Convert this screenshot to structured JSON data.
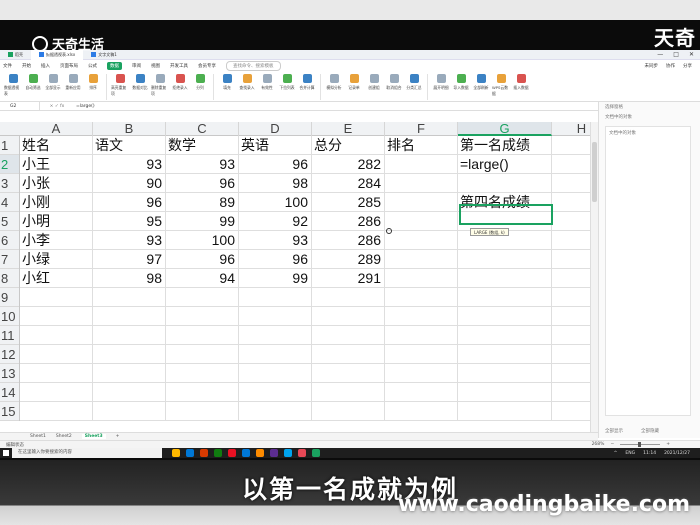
{
  "watermark": {
    "logo_text": "天奇生活",
    "corner_text": "天奇",
    "url": "www.caodingbaike.com"
  },
  "caption": "以第一名成就为例",
  "titlebar": {
    "tabs": [
      {
        "label": "稻壳"
      },
      {
        "label": "数据透视表.xlsx",
        "active": true
      },
      {
        "label": "文字文稿1"
      }
    ],
    "controls": [
      "—",
      "□",
      "✕"
    ]
  },
  "menubar": {
    "items": [
      "文件",
      "开始",
      "插入",
      "页面布局",
      "公式",
      "数据",
      "审阅",
      "视图",
      "开发工具",
      "会员专享"
    ],
    "active_index": 5,
    "search_placeholder": "查找命令、搜索模板",
    "right": [
      "未同步",
      "协作",
      "分享"
    ]
  },
  "ribbon": {
    "buttons": [
      {
        "label": "数据透视表",
        "color": "b"
      },
      {
        "label": "自动筛选",
        "color": "g"
      },
      {
        "label": "全部显示",
        "color": ""
      },
      {
        "label": "重新应用",
        "color": ""
      },
      {
        "label": "排序",
        "color": "o"
      },
      {
        "label": "高亮重复项",
        "color": "r"
      },
      {
        "label": "数据对比",
        "color": "b"
      },
      {
        "label": "删除重复项",
        "color": ""
      },
      {
        "label": "拒绝录入",
        "color": "r"
      },
      {
        "label": "分列",
        "color": "g"
      },
      {
        "label": "填充",
        "color": "b"
      },
      {
        "label": "查找录入",
        "color": "o"
      },
      {
        "label": "有效性",
        "color": ""
      },
      {
        "label": "下拉列表",
        "color": "g"
      },
      {
        "label": "合并计算",
        "color": "b"
      },
      {
        "label": "模拟分析",
        "color": ""
      },
      {
        "label": "记录单",
        "color": "o"
      },
      {
        "label": "创建组",
        "color": ""
      },
      {
        "label": "取消组合",
        "color": ""
      },
      {
        "label": "分类汇总",
        "color": "b"
      },
      {
        "label": "展开明细",
        "color": ""
      },
      {
        "label": "导入数据",
        "color": "g"
      },
      {
        "label": "全部刷新",
        "color": "b"
      },
      {
        "label": "WPS云数据",
        "color": "o"
      },
      {
        "label": "插入数据",
        "color": "r"
      }
    ]
  },
  "formula_bar": {
    "name_box": "G2",
    "fx": "× ✓ fx",
    "formula": "=large()"
  },
  "grid": {
    "columns": [
      "A",
      "B",
      "C",
      "D",
      "E",
      "F",
      "G",
      "H"
    ],
    "selected_column": "G",
    "row_numbers": [
      "1",
      "2",
      "3",
      "4",
      "5",
      "6",
      "7",
      "8",
      "9",
      "10",
      "11",
      "12",
      "13",
      "14",
      "15"
    ],
    "selected_row": "2",
    "rows": [
      [
        "姓名",
        "语文",
        "数学",
        "英语",
        "总分",
        "排名",
        "第一名成绩",
        ""
      ],
      [
        "小王",
        "93",
        "93",
        "96",
        "282",
        "",
        "=large()",
        ""
      ],
      [
        "小张",
        "90",
        "96",
        "98",
        "284",
        "",
        "",
        ""
      ],
      [
        "小刚",
        "96",
        "89",
        "100",
        "285",
        "",
        "第四名成绩",
        ""
      ],
      [
        "小明",
        "95",
        "99",
        "92",
        "286",
        "",
        "",
        ""
      ],
      [
        "小李",
        "93",
        "100",
        "93",
        "286",
        "",
        "",
        ""
      ],
      [
        "小绿",
        "97",
        "96",
        "96",
        "289",
        "",
        "",
        ""
      ],
      [
        "小红",
        "98",
        "94",
        "99",
        "291",
        "",
        "",
        ""
      ],
      [
        "",
        "",
        "",
        "",
        "",
        "",
        "",
        ""
      ],
      [
        "",
        "",
        "",
        "",
        "",
        "",
        "",
        ""
      ],
      [
        "",
        "",
        "",
        "",
        "",
        "",
        "",
        ""
      ],
      [
        "",
        "",
        "",
        "",
        "",
        "",
        "",
        ""
      ],
      [
        "",
        "",
        "",
        "",
        "",
        "",
        "",
        ""
      ],
      [
        "",
        "",
        "",
        "",
        "",
        "",
        "",
        ""
      ],
      [
        "",
        "",
        "",
        "",
        "",
        "",
        "",
        ""
      ]
    ],
    "tooltip": "LARGE (数组, k)"
  },
  "side_panel": {
    "header": "选择窗格",
    "subheader": "文档中的对象",
    "inner_label": "文档中的对象",
    "footer": [
      "全部显示",
      "全部隐藏"
    ]
  },
  "sheets": {
    "tabs": [
      "Sheet1",
      "Sheet2",
      "Sheet3"
    ],
    "active_index": 2,
    "add": "+"
  },
  "status_bar": {
    "left": "编辑状态",
    "zoom": "268%"
  },
  "taskbar": {
    "search_placeholder": "在这里输入你要搜索的内容",
    "app_colors": [
      "#ffb900",
      "#0078d7",
      "#d83b01",
      "#107c10",
      "#e81123",
      "#0078d7",
      "#ff8c00",
      "#5c2d91",
      "#00a4ef",
      "#e74856",
      "#1aa260"
    ],
    "tray": [
      "^",
      "ENG",
      "11:14",
      "2021/12/27"
    ]
  }
}
